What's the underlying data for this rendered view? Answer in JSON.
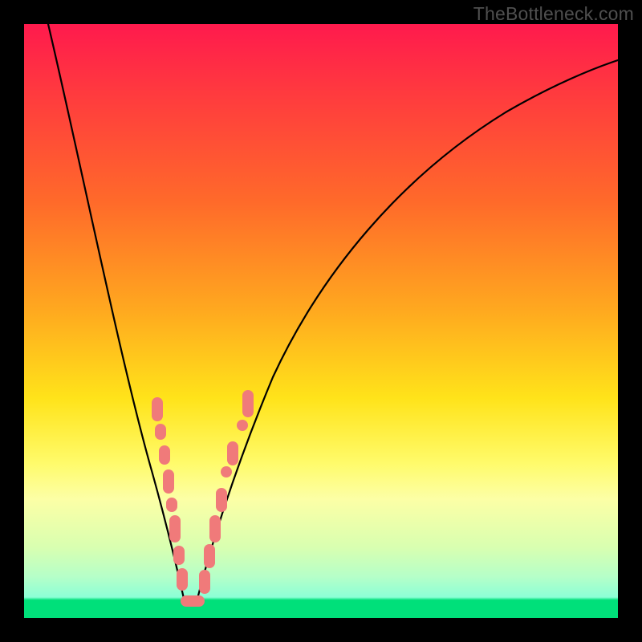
{
  "watermark": "TheBottleneck.com",
  "colors": {
    "frame": "#000000",
    "blob": "#f07a7a",
    "curve": "#000000",
    "gradient_top": "#ff1a4d",
    "gradient_bottom": "#00e07a"
  },
  "chart_data": {
    "type": "line",
    "title": "",
    "xlabel": "",
    "ylabel": "",
    "xlim": [
      0,
      100
    ],
    "ylim": [
      0,
      100
    ],
    "note": "Bottleneck-style V curve. x is a normalized performance-ratio axis (0–100). y is bottleneck percentage (0 at the notch, 100 at the top). Values estimated from pixel geometry; axes are unlabeled in the source image.",
    "series": [
      {
        "name": "bottleneck_percent",
        "x": [
          0,
          4,
          8,
          12,
          15,
          18,
          20,
          22,
          24,
          25.5,
          27,
          28.5,
          30,
          33,
          37,
          42,
          48,
          55,
          63,
          72,
          82,
          92,
          100
        ],
        "y": [
          100,
          88,
          76,
          64,
          54,
          44,
          35,
          26,
          16,
          6,
          0,
          0,
          6,
          16,
          28,
          40,
          51,
          61,
          70,
          77,
          82,
          86,
          89
        ]
      }
    ],
    "green_zone_y_max": 3,
    "annotations": {
      "description": "Pink blobs along both arms of the V near the green zone indicate sampled hardware pairings.",
      "left_arm_blobs_y_range": [
        3,
        38
      ],
      "right_arm_blobs_y_range": [
        0,
        42
      ]
    }
  }
}
